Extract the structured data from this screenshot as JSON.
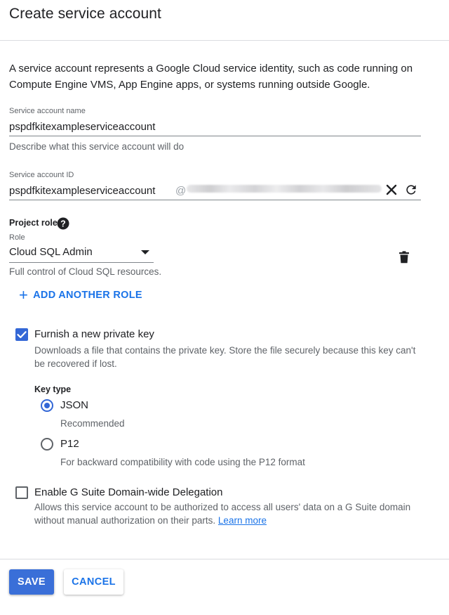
{
  "header": {
    "title": "Create service account"
  },
  "description": "A service account represents a Google Cloud service identity, such as code running on Compute Engine VMS, App Engine apps, or systems running outside Google.",
  "service_account_name": {
    "label": "Service account name",
    "value": "pspdfkitexampleserviceaccount",
    "helper_placeholder": "Describe what this service account will do"
  },
  "service_account_id": {
    "label": "Service account ID",
    "value": "pspdfkitexampleserviceaccount",
    "domain_prefix": "@"
  },
  "project_role": {
    "heading": "Project role",
    "role_label": "Role",
    "selected_role": "Cloud SQL Admin",
    "role_description": "Full control of Cloud SQL resources.",
    "add_another_label": "ADD ANOTHER ROLE"
  },
  "private_key": {
    "checked": true,
    "label": "Furnish a new private key",
    "description": "Downloads a file that contains the private key. Store the file securely because this key can't be recovered if lost.",
    "key_type_label": "Key type",
    "options": [
      {
        "label": "JSON",
        "hint": "Recommended",
        "selected": true
      },
      {
        "label": "P12",
        "hint": "For backward compatibility with code using the P12 format",
        "selected": false
      }
    ]
  },
  "delegation": {
    "checked": false,
    "label": "Enable G Suite Domain-wide Delegation",
    "description": "Allows this service account to be authorized to access all users' data on a G Suite domain without manual authorization on their parts.",
    "learn_more": "Learn more"
  },
  "footer": {
    "save_label": "SAVE",
    "cancel_label": "CANCEL"
  },
  "colors": {
    "accent": "#1a73e8",
    "primary_button": "#3a6fd8",
    "checkbox": "#3367d6"
  },
  "icons": [
    "help-icon",
    "clear-icon",
    "refresh-icon",
    "delete-icon",
    "dropdown-arrow-icon",
    "plus-icon",
    "check-icon"
  ]
}
